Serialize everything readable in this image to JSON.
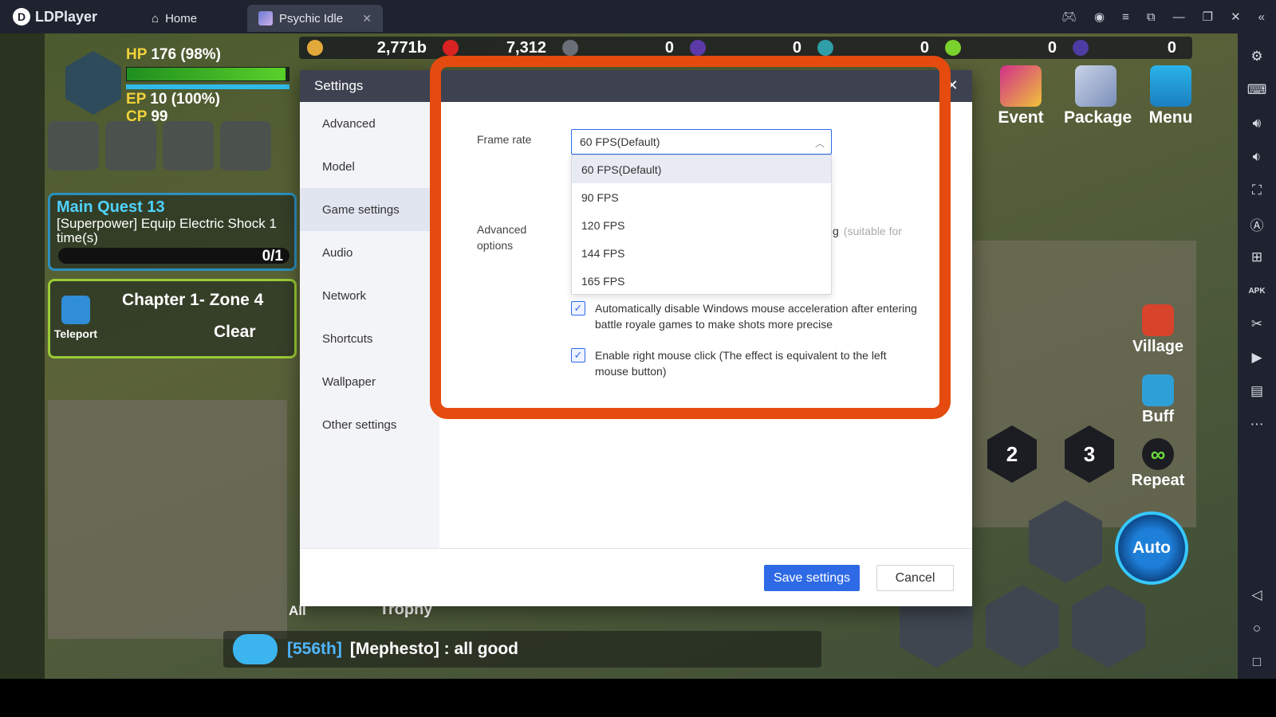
{
  "titlebar": {
    "app_name": "LDPlayer",
    "tabs": [
      {
        "label": "Home",
        "icon": "home-icon"
      },
      {
        "label": "Psychic Idle",
        "icon": "game-icon"
      }
    ]
  },
  "game": {
    "resources": [
      "2,771b",
      "7,312",
      "0",
      "0",
      "0",
      "0",
      "0"
    ],
    "player": {
      "hp": "176 (98%)",
      "ep": "10 (100%)",
      "cp": "99",
      "hp_label": "HP",
      "ep_label": "EP",
      "cp_label": "CP"
    },
    "quest": {
      "title": "Main Quest 13",
      "desc": "[Superpower] Equip Electric Shock 1 time(s)",
      "progress": "0/1"
    },
    "chapter": {
      "title": "Chapter 1- Zone 4",
      "status": "Clear",
      "teleport": "Teleport"
    },
    "menu": {
      "event": "Event",
      "package": "Package",
      "menu": "Menu"
    },
    "side": {
      "village": "Village",
      "buff": "Buff",
      "repeat": "Repeat"
    },
    "slots": [
      "2",
      "3"
    ],
    "auto": "Auto",
    "chat": {
      "tab_all": "All",
      "tab_trophy": "Trophy",
      "rank": "[556th]",
      "message": "[Mephesto] : all good"
    }
  },
  "settings": {
    "title": "Settings",
    "nav": [
      "Advanced",
      "Model",
      "Game settings",
      "Audio",
      "Network",
      "Shortcuts",
      "Wallpaper",
      "Other settings"
    ],
    "active_nav": "Game settings",
    "frame_rate_label": "Frame rate",
    "frame_rate_value": "60 FPS(Default)",
    "frame_rate_options": [
      "60 FPS(Default)",
      "90 FPS",
      "120 FPS",
      "144 FPS",
      "165 FPS"
    ],
    "advanced_label": "Advanced options",
    "hint_visible": "g",
    "hint_muted": "(suitable for",
    "checkbox_1": "Automatically disable Windows mouse acceleration after entering battle royale games to make shots more precise",
    "checkbox_2": "Enable right mouse click (The effect is equivalent to the left mouse button)",
    "save_label": "Save settings",
    "cancel_label": "Cancel"
  },
  "colors": {
    "accent": "#2e6ae6",
    "highlight": "#e54b0e",
    "titlebar": "#1f2330"
  }
}
